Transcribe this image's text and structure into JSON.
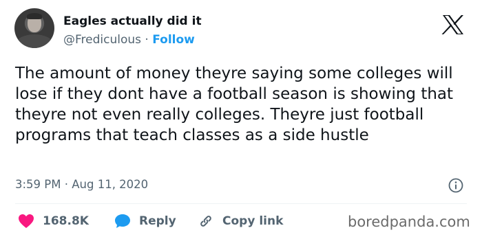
{
  "user": {
    "display_name": "Eagles actually did it",
    "handle": "@Frediculous",
    "separator": "·",
    "follow_label": "Follow"
  },
  "tweet": {
    "text": "The amount of money theyre saying some colleges will lose if they dont have a football season is showing that theyre not even really colleges. Theyre just football programs that teach classes as a side hustle",
    "time": "3:59 PM",
    "date_separator": "·",
    "date": "Aug 11, 2020"
  },
  "actions": {
    "like_count": "168.8K",
    "reply_label": "Reply",
    "copy_link_label": "Copy link"
  },
  "watermark": "boredpanda.com",
  "icons": {
    "logo": "x-logo-icon",
    "info": "info-icon",
    "like": "heart-icon",
    "reply": "speech-bubble-icon",
    "copy_link": "link-icon"
  },
  "colors": {
    "text": "#0f1419",
    "secondary": "#536471",
    "follow": "#1d9bf0",
    "heart": "#f91880",
    "reply_bubble": "#1d9bf0"
  }
}
